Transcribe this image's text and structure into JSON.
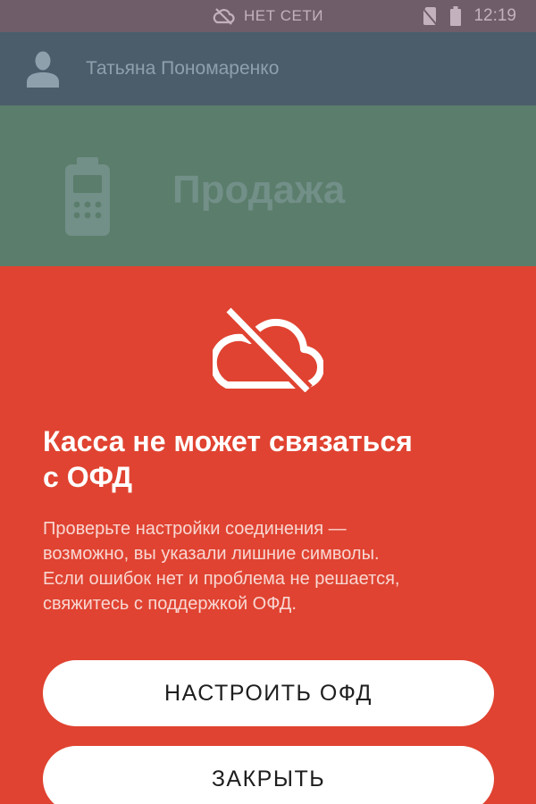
{
  "status_bar": {
    "network_status": "НЕТ СЕТИ",
    "time": "12:19",
    "icons": [
      "cloud-off-icon",
      "no-sim-icon",
      "battery-icon"
    ]
  },
  "user": {
    "name": "Татьяна Пономаренко",
    "icon": "user-icon"
  },
  "sale_tile": {
    "label": "Продажа",
    "icon": "pos-terminal-icon"
  },
  "dialog": {
    "icon": "cloud-off-icon",
    "title_line1": "Касса не может связаться",
    "title_line2": "с ОФД",
    "text_lines": [
      "Проверьте настройки соединения —",
      "возможно, вы указали лишние символы.",
      "Если ошибок нет и проблема не решается,",
      "свяжитесь с поддержкой ОФД."
    ],
    "configure_button": "НАСТРОИТЬ ОФД",
    "close_button": "ЗАКРЫТЬ"
  },
  "colors": {
    "status_bar": "#705d6a",
    "user_bar": "#4b5d6b",
    "sale_tile": "#5b7d6c",
    "dialog_background": "#e04331",
    "button_background": "#ffffff"
  }
}
